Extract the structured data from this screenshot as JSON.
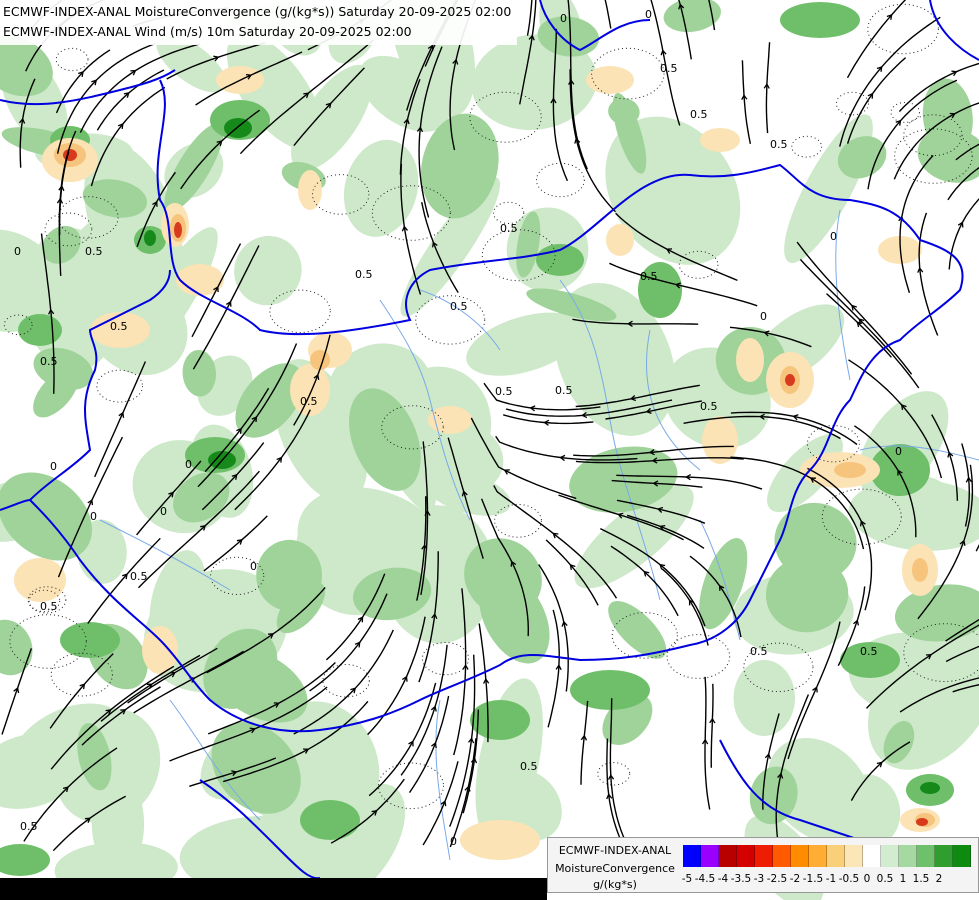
{
  "header": {
    "title_line_1": "ECMWF-INDEX-ANAL MoistureConvergence (g/(kg*s)) Saturday 20-09-2025 02:00",
    "title_line_2": "ECMWF-INDEX-ANAL Wind (m/s) 10m Saturday 20-09-2025 02:00"
  },
  "map": {
    "contour_labels": [
      "0",
      "0.5"
    ],
    "colors": {
      "green_light": "#cde9c9",
      "green_mid": "#9fd39a",
      "green": "#6fbf6a",
      "green_dark": "#37a335",
      "green_darker": "#158a1a",
      "orange_light": "#fbe3b5",
      "orange": "#f6c47d",
      "orange_dark": "#f29a3a",
      "red": "#d73a1c",
      "border": "#0000e0",
      "river": "#7aa9e8",
      "streamline": "#000000"
    }
  },
  "legend": {
    "name_line_1": "ECMWF-INDEX-ANAL",
    "name_line_2": "MoistureConvergence",
    "units": "g/(kg*s)",
    "scale": [
      {
        "label": "-5",
        "color": "#0000ff"
      },
      {
        "label": "-4.5",
        "color": "#9a00ff"
      },
      {
        "label": "-4",
        "color": "#b80000"
      },
      {
        "label": "-3.5",
        "color": "#d40000"
      },
      {
        "label": "-3",
        "color": "#ee1c00"
      },
      {
        "label": "-2.5",
        "color": "#ff5a00"
      },
      {
        "label": "-2",
        "color": "#ff8c00"
      },
      {
        "label": "-1.5",
        "color": "#ffad33"
      },
      {
        "label": "-1",
        "color": "#f9cf7a"
      },
      {
        "label": "-0.5",
        "color": "#fbe6b8"
      },
      {
        "label": "0",
        "color": "#ffffff"
      },
      {
        "label": "0.5",
        "color": "#d2ecd0"
      },
      {
        "label": "1",
        "color": "#a6d8a2"
      },
      {
        "label": "1.5",
        "color": "#6fc06b"
      },
      {
        "label": "2",
        "color": "#2f9e2f"
      },
      {
        "label": "",
        "color": "#0f8a10"
      }
    ]
  }
}
